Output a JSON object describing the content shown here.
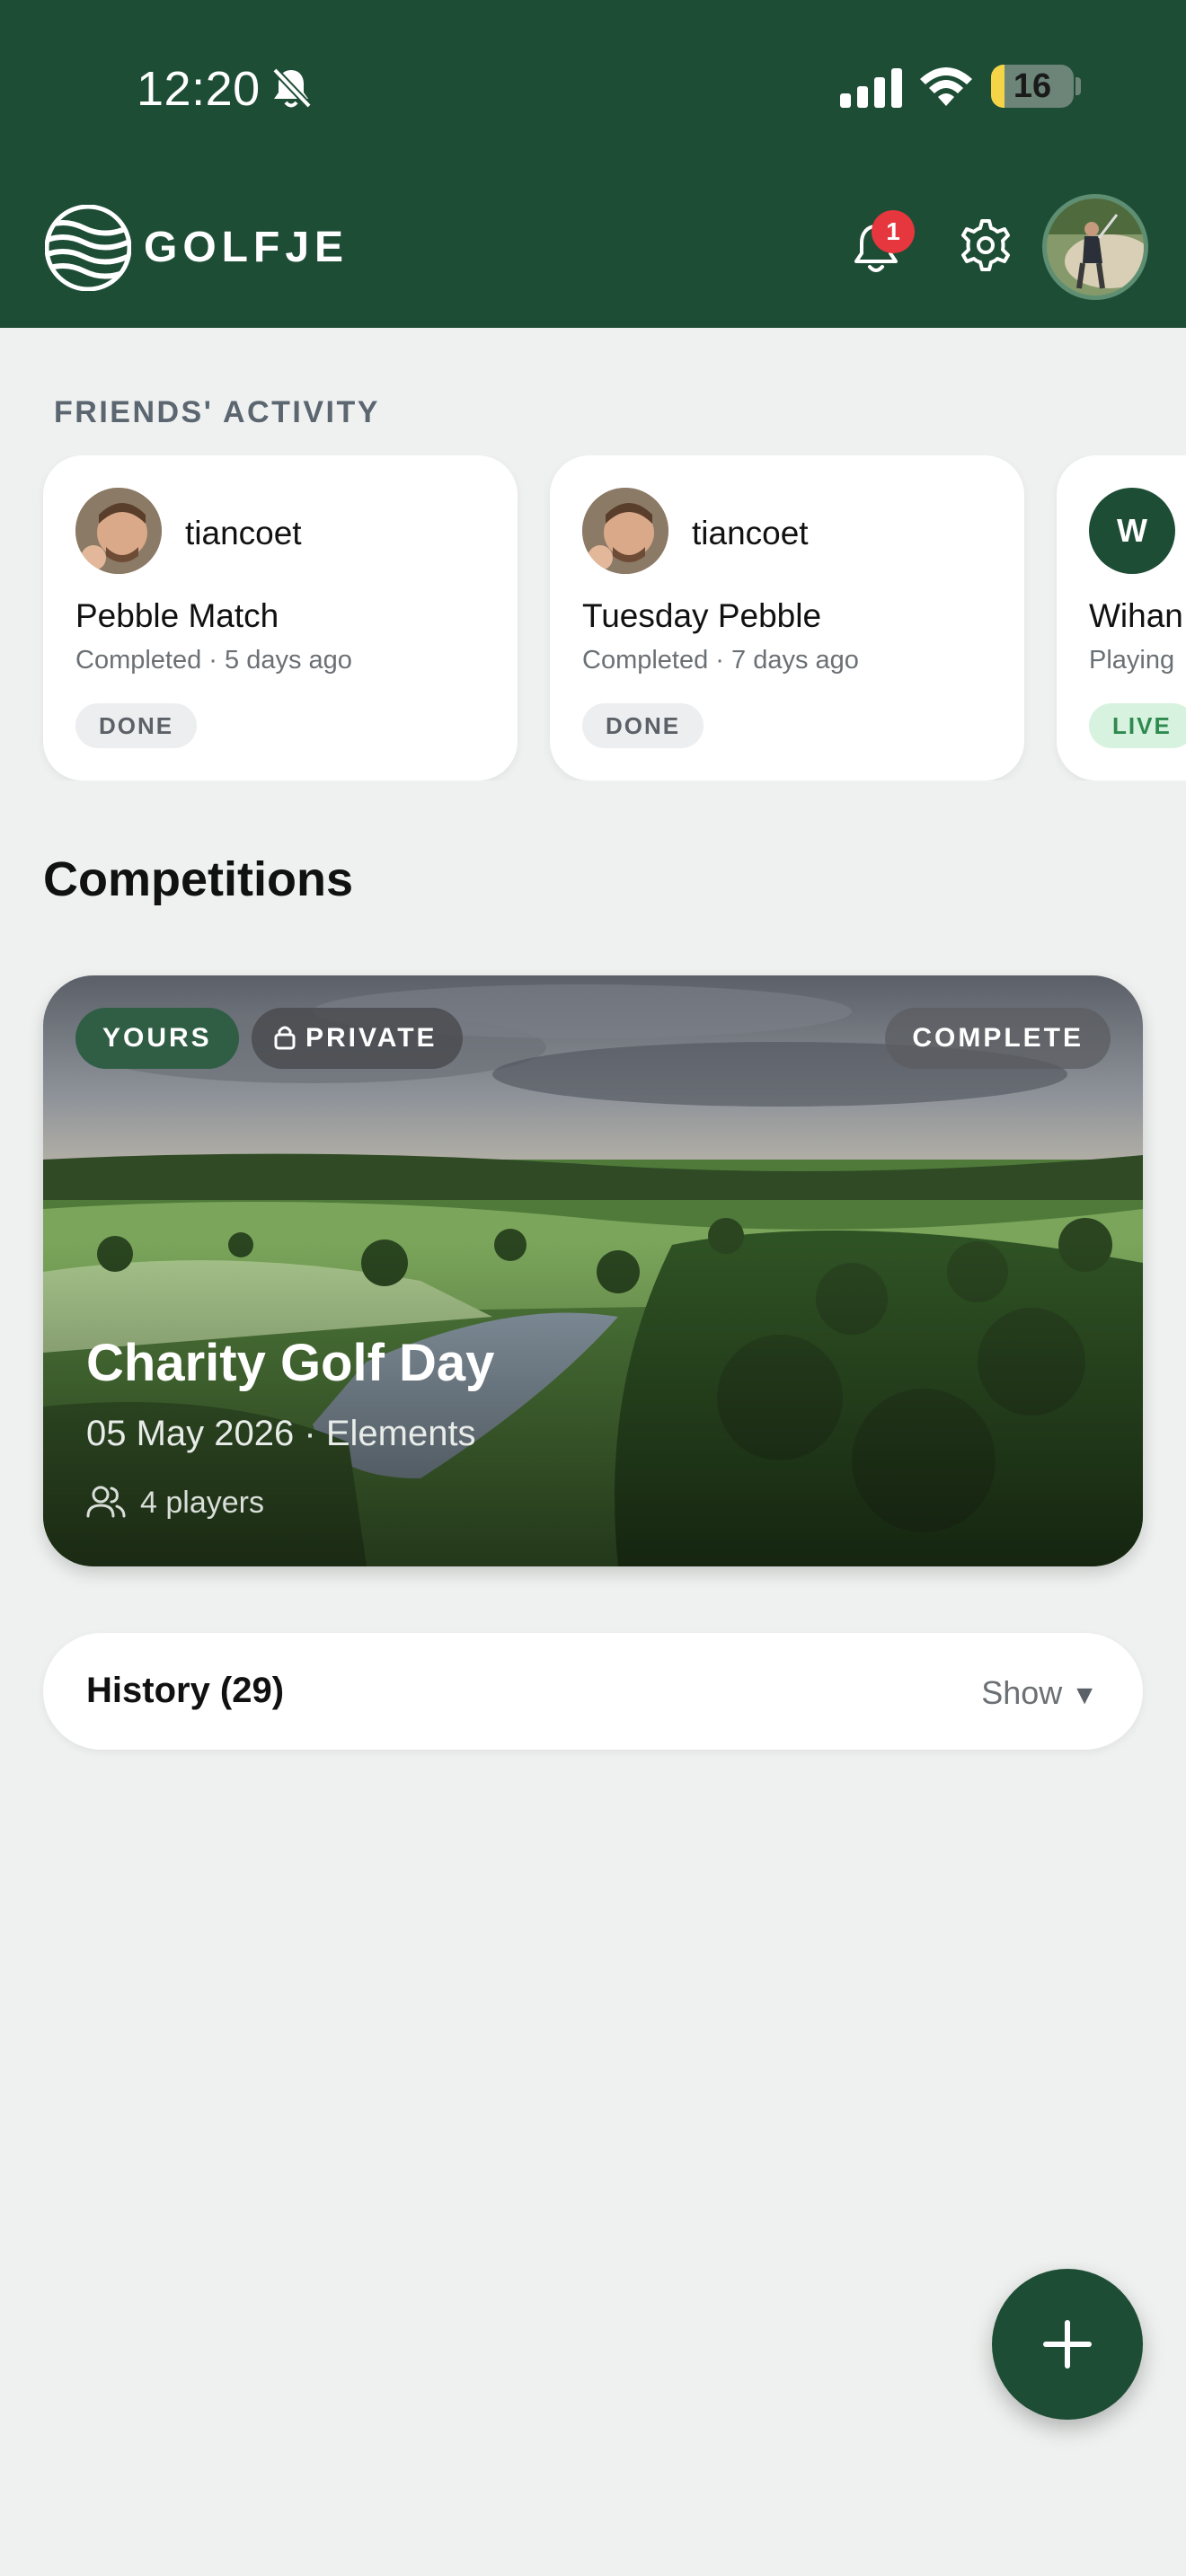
{
  "status_bar": {
    "time": "12:20",
    "battery": "16",
    "battery_level": 0.16
  },
  "header": {
    "brand": "GOLFJE",
    "notification_count": "1"
  },
  "friends_activity": {
    "label": "FRIENDS' ACTIVITY",
    "cards": [
      {
        "user": "tiancoet",
        "title": "Pebble Match",
        "meta": "Completed · 5 days ago",
        "badge": "DONE",
        "avatar_letter": ""
      },
      {
        "user": "tiancoet",
        "title": "Tuesday Pebble",
        "meta": "Completed · 7 days ago",
        "badge": "DONE",
        "avatar_letter": ""
      },
      {
        "user": "Wihan",
        "title": "",
        "meta": "Playing",
        "badge": "LIVE",
        "avatar_letter": "W"
      }
    ]
  },
  "competitions": {
    "heading": "Competitions",
    "card": {
      "tag_yours": "YOURS",
      "tag_private": "PRIVATE",
      "status": "COMPLETE",
      "title": "Charity Golf Day",
      "subtitle": "05 May 2026 · Elements",
      "players": "4 players"
    }
  },
  "history": {
    "label": "History (29)",
    "toggle": "Show"
  },
  "colors": {
    "brand_green": "#1e4d36",
    "badge_red": "#e5373d",
    "live_green": "#2f8a4f"
  }
}
